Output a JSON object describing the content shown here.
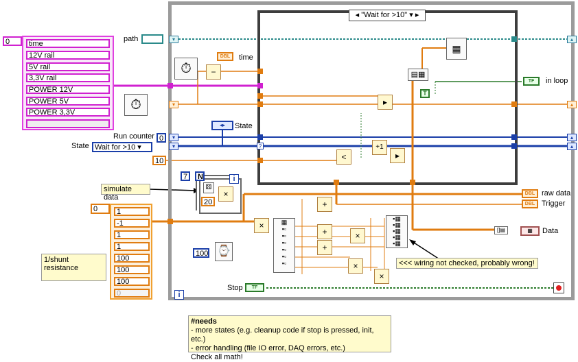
{
  "case_selector": {
    "label": "\"Wait for >10\"",
    "left_arrow": "◂",
    "right_arrow": "▸",
    "dropdown": "▾"
  },
  "cluster": {
    "index": "0",
    "items": [
      "time",
      "12V rail",
      "5V rail",
      "3,3V rail",
      "POWER 12V",
      "POWER 5V",
      "POWER 3,3V"
    ]
  },
  "array": {
    "index": "0",
    "items": [
      "1",
      "-1",
      "1",
      "1",
      "100",
      "100",
      "100",
      "0"
    ]
  },
  "labels": {
    "path": "path",
    "time": "time",
    "state_inner": "State",
    "run_counter": "Run counter",
    "state_outer": "State",
    "in_loop": "in loop",
    "raw_data": "raw data",
    "trigger": "Trigger",
    "data": "Data",
    "stop": "Stop"
  },
  "constants": {
    "run_counter_value": "0",
    "state_value": "Wait for >10",
    "ten": "10",
    "seven": "7",
    "twenty": "20",
    "hundred": "100",
    "n": "N",
    "i_small": "i",
    "i_loop": "i"
  },
  "terminals": {
    "dbl": "DBL",
    "tf": "TF",
    "t": "T"
  },
  "notes": {
    "simulate_data": "simulate data",
    "shunt": "1/shunt resistance",
    "wiring": "<<< wiring not checked, probably wrong!",
    "needs_title": "#needs",
    "needs_lines": [
      "- more states (e.g. cleanup code if stop is pressed, init, etc.)",
      "- error handling (file IO error, DAQ errors, etc.)",
      "Check all math!"
    ]
  },
  "operators": {
    "minus": "−",
    "plus": "+",
    "times": "×",
    "less": "<",
    "inc": "+1",
    "select": "▸"
  },
  "colors": {
    "orange": "#e07c10",
    "blue": "#1a3ea8",
    "pink": "#d020d0",
    "teal": "#2a8a8a",
    "green": "#2a7a2a",
    "gray_frame": "#9b9b9b"
  },
  "icons": [
    "stopwatch-icon",
    "stopwatch-icon",
    "wait-ms-icon",
    "write-file-icon",
    "stop-button-icon",
    "build-array-icon",
    "bundle-icon",
    "unbundle-icon"
  ]
}
